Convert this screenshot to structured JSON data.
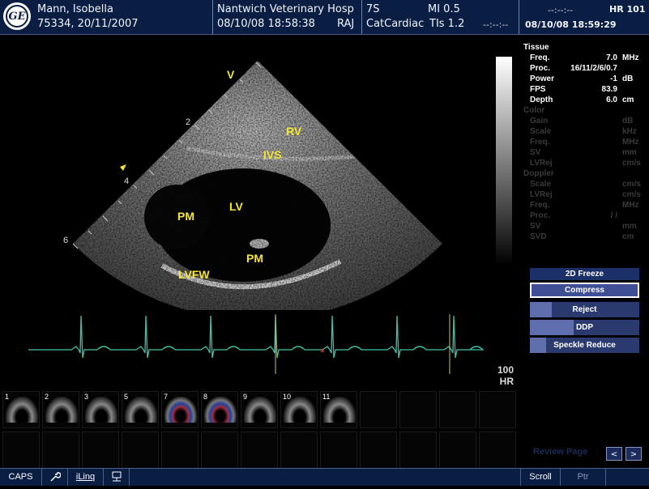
{
  "header": {
    "patient_name": "Mann, Isobella",
    "patient_id_dob": "75334, 20/11/2007",
    "hospital": "Nantwich Veterinary Hosp",
    "datetime_left": "08/10/08 18:58:38",
    "operator": "RAJ",
    "probe": "7S",
    "mi": "MI 0.5",
    "preset": "CatCardiac",
    "tis": "TIs 1.2",
    "dashes_mid": "--:--:--",
    "dashes_right": "--:--:--",
    "hr": "HR 101",
    "datetime_right": "08/10/08 18:59:29"
  },
  "image_labels": {
    "v_marker": "V",
    "rv": "RV",
    "ivs": "IVS",
    "lv": "LV",
    "pm_left": "PM",
    "pm_bottom": "PM",
    "lvfw": "LVFW",
    "depth_2": "2",
    "depth_4": "4",
    "depth_6": "6"
  },
  "params": {
    "tissue_title": "Tissue",
    "tissue": [
      {
        "k": "Freq.",
        "v": "7.0",
        "u": "MHz"
      },
      {
        "k": "Proc.",
        "v": "16/11/2/6/0.7",
        "u": ""
      },
      {
        "k": "Power",
        "v": "-1",
        "u": "dB"
      },
      {
        "k": "FPS",
        "v": "83.9",
        "u": ""
      },
      {
        "k": "Depth",
        "v": "6.0",
        "u": "cm"
      }
    ],
    "color_title": "Color",
    "color": [
      {
        "k": "Gain",
        "v": "",
        "u": "dB"
      },
      {
        "k": "Scale",
        "v": "",
        "u": "kHz"
      },
      {
        "k": "Freq.",
        "v": "",
        "u": "MHz"
      },
      {
        "k": "SV",
        "v": "",
        "u": "mm"
      },
      {
        "k": "LVRej",
        "v": "",
        "u": "cm/s"
      }
    ],
    "doppler_title": "Doppler",
    "doppler": [
      {
        "k": "Scale",
        "v": "",
        "u": "cm/s"
      },
      {
        "k": "LVRej",
        "v": "",
        "u": "cm/s"
      },
      {
        "k": "Freq.",
        "v": "",
        "u": "MHz"
      },
      {
        "k": "Proc.",
        "v": "/ /",
        "u": ""
      },
      {
        "k": "SV",
        "v": "",
        "u": "mm"
      },
      {
        "k": "SVD",
        "v": "",
        "u": "cm"
      }
    ]
  },
  "menu": {
    "title": "2D Freeze",
    "compress": "Compress",
    "reject": "Reject",
    "reject_level": 0.2,
    "ddp": "DDP",
    "ddp_level": 0.4,
    "speckle": "Speckle Reduce",
    "speckle_level": 0.15
  },
  "ecg": {
    "hr_value": "100",
    "hr_unit": "HR",
    "trace_color": "#3fc1a8",
    "marker_color": "#c8c06a"
  },
  "thumbnails": [
    {
      "n": "1",
      "type": "2d"
    },
    {
      "n": "2",
      "type": "2d"
    },
    {
      "n": "3",
      "type": "2d"
    },
    {
      "n": "5",
      "type": "2d"
    },
    {
      "n": "7",
      "type": "color"
    },
    {
      "n": "8",
      "type": "color"
    },
    {
      "n": "9",
      "type": "2d"
    },
    {
      "n": "10",
      "type": "2d"
    },
    {
      "n": "11",
      "type": "2d"
    }
  ],
  "review": {
    "label": "Review Page",
    "prev": "<",
    "next": ">"
  },
  "footer": {
    "caps": "CAPS",
    "wrench_icon": "wrench-icon",
    "iling": "iLinq",
    "network_icon": "network-icon",
    "scroll": "Scroll",
    "ptr": "Ptr"
  },
  "colors": {
    "header_bg": "#0a1e44",
    "label_yellow": "#f4e531",
    "menu_button": "#2a3a6e"
  }
}
